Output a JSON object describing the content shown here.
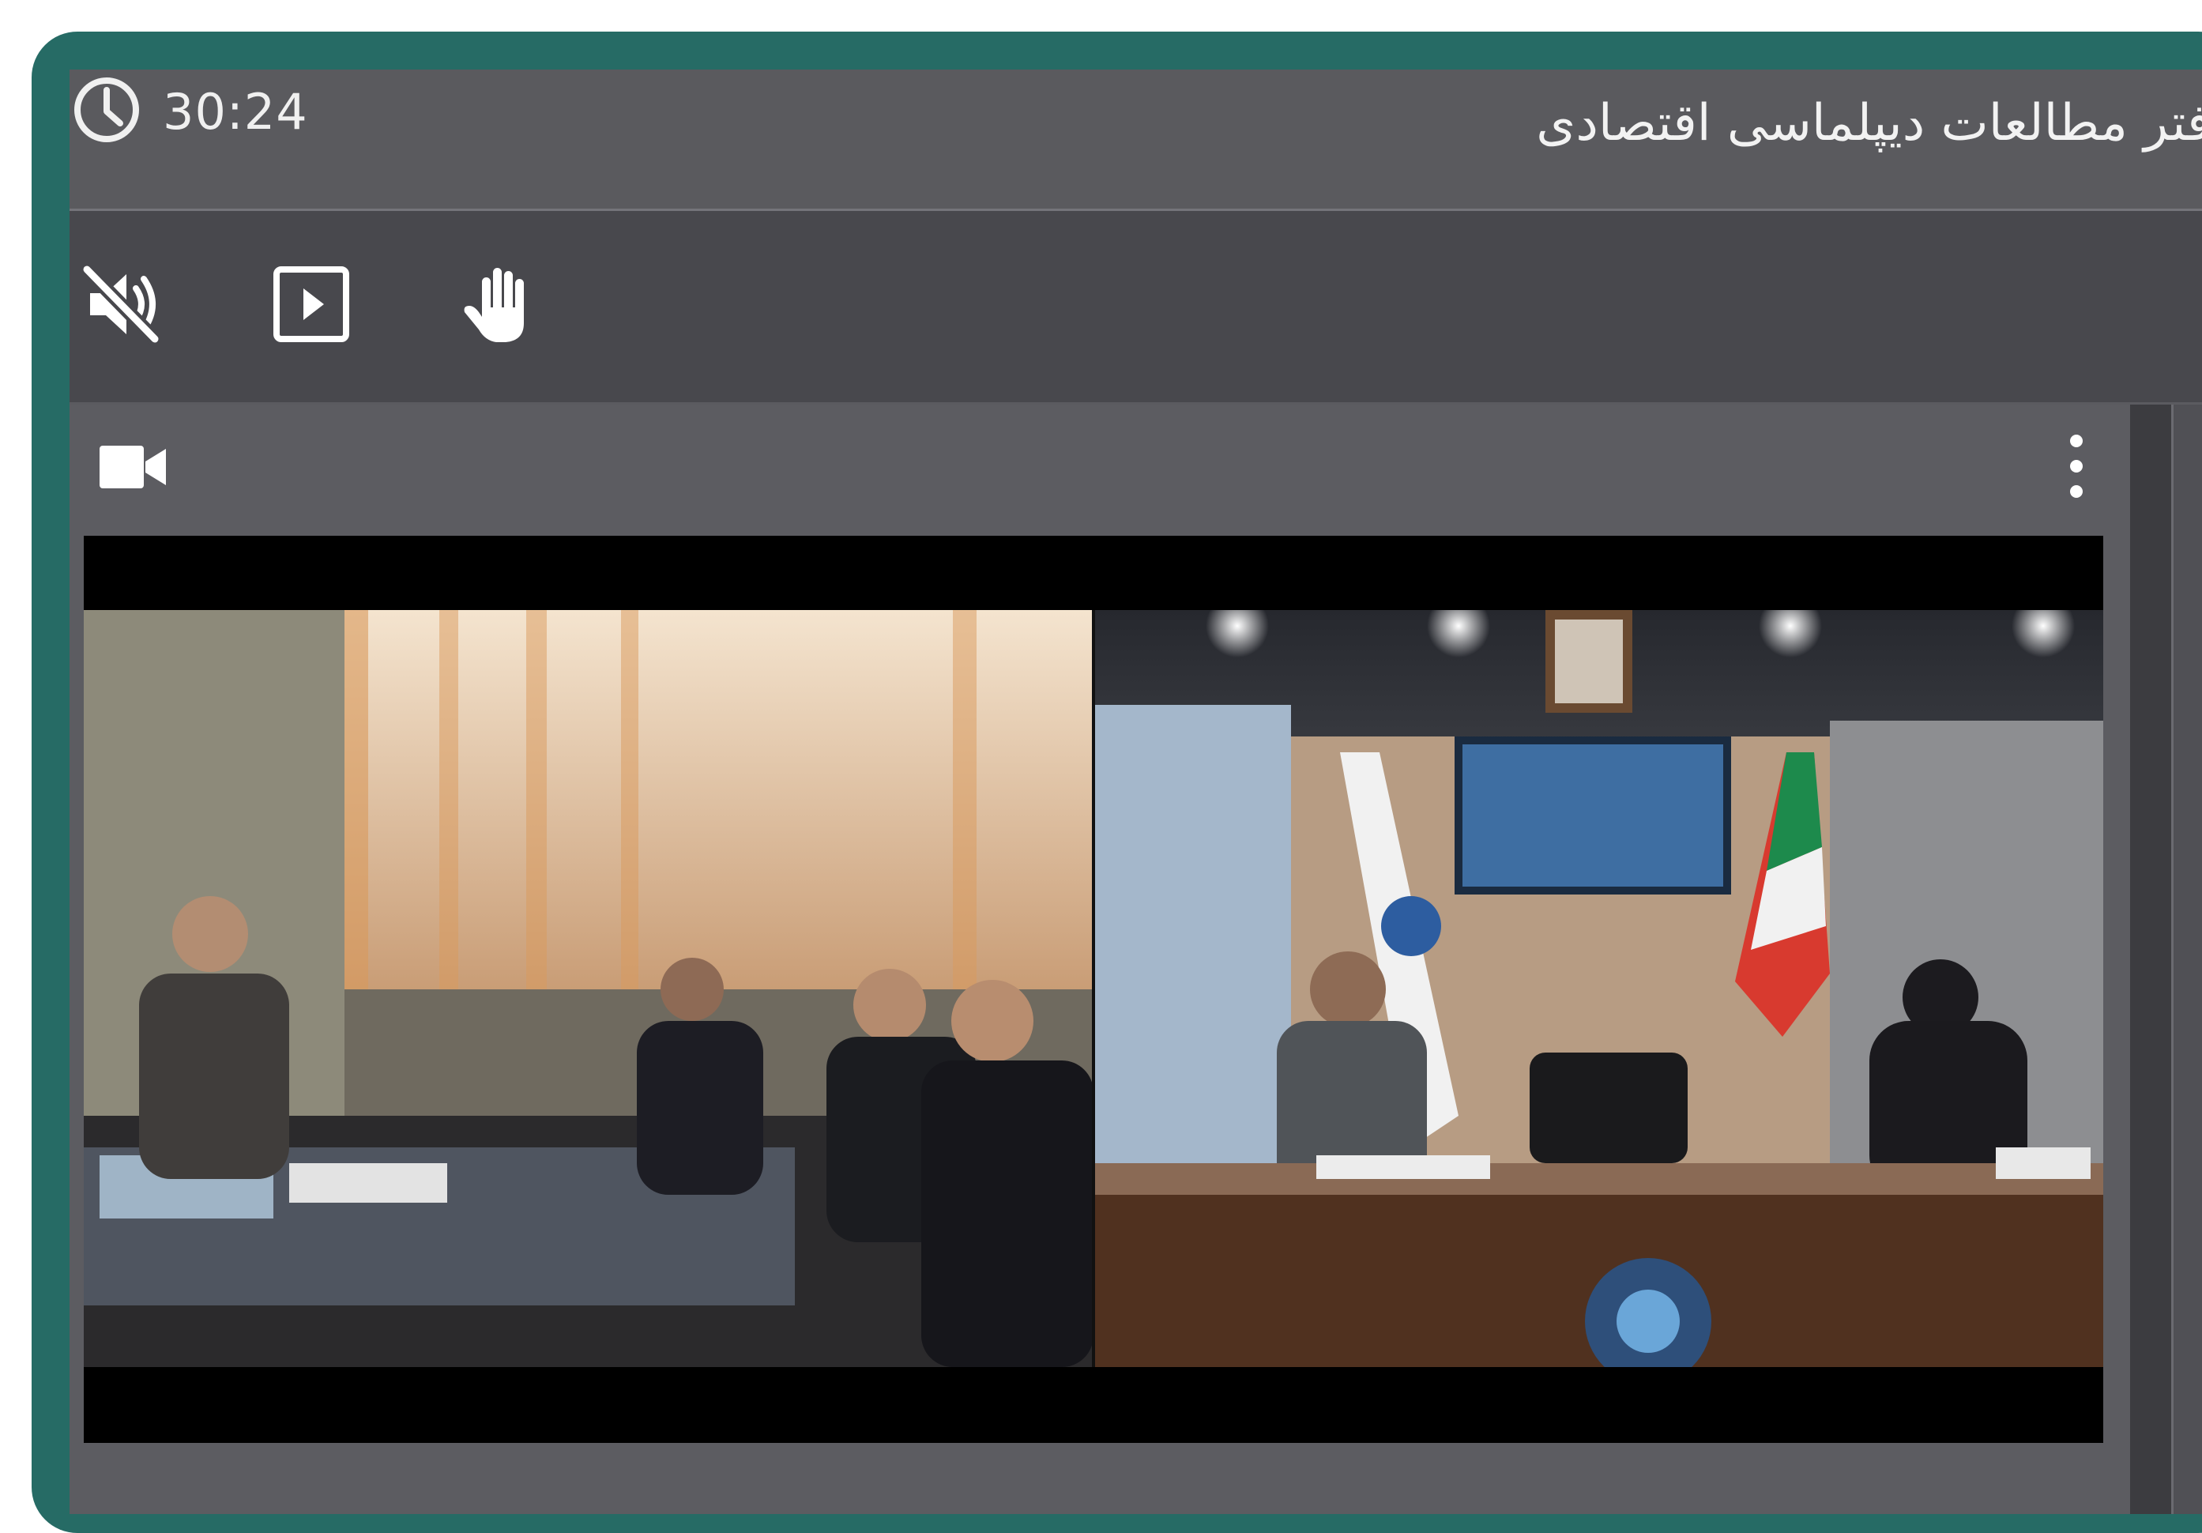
{
  "session": {
    "elapsed_time": "30:24",
    "room_title": "دفتر مطالعات دیپلماسی اقتصادی"
  },
  "toolbar": {
    "mute_icon": "speaker-muted-icon",
    "media_icon": "play-box-icon",
    "raise_hand_icon": "raised-hand-icon"
  },
  "video_panel": {
    "header_icon": "video-camera-icon",
    "menu_icon": "more-vertical-icon"
  },
  "colors": {
    "frame": "#266b65",
    "titlebar": "#5a5a5e",
    "toolbar": "#48484d",
    "panel": "#5c5c61",
    "icon": "#ffffff"
  }
}
